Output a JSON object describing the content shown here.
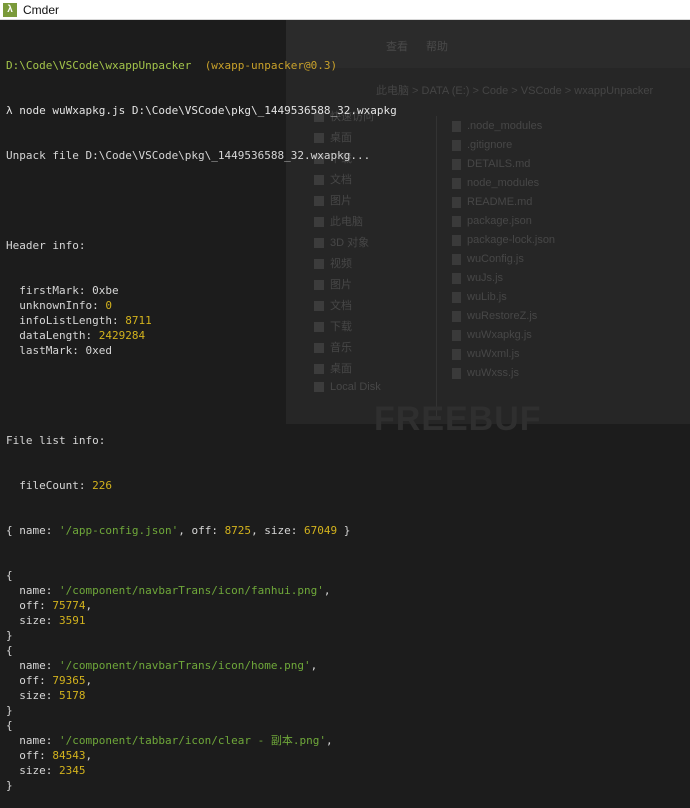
{
  "window": {
    "title": "Cmder"
  },
  "background": {
    "tabs": [
      "查看",
      "帮助"
    ],
    "address": "  此电脑  >  DATA (E:)  >  Code  >  VSCode  >  wxappUnpacker",
    "sidebar": [
      "快速访问",
      "桌面",
      "下载",
      "文档",
      "图片",
      "此电脑",
      "3D 对象",
      "视频",
      "图片",
      "文档",
      "下载",
      "音乐",
      "桌面",
      "Local Disk"
    ],
    "files": [
      ".node_modules",
      ".gitignore",
      "DETAILS.md",
      "node_modules",
      "README.md",
      "package.json",
      "package-lock.json",
      "wuConfig.js",
      "wuJs.js",
      "wuLib.js",
      "wuRestoreZ.js",
      "wuWxapkg.js",
      "wuWxml.js",
      "wuWxss.js"
    ],
    "watermark": "FREEBUF"
  },
  "console": {
    "prompt_path": "D:\\Code\\VSCode\\wxappUnpacker",
    "prompt_pkg": "(wxapp-unpacker@0.3)",
    "command": "λ node wuWxapkg.js D:\\Code\\VSCode\\pkg\\_1449536588_32.wxapkg",
    "unpack_line": "Unpack file D:\\Code\\VSCode\\pkg\\_1449536588_32.wxapkg...",
    "header_title": "Header info:",
    "header": [
      {
        "key": "  firstMark: ",
        "value": "0xbe",
        "type": "plain"
      },
      {
        "key": "  unknownInfo: ",
        "value": "0",
        "type": "num"
      },
      {
        "key": "  infoListLength: ",
        "value": "8711",
        "type": "num"
      },
      {
        "key": "  dataLength: ",
        "value": "2429284",
        "type": "num"
      },
      {
        "key": "  lastMark: ",
        "value": "0xed",
        "type": "plain"
      }
    ],
    "filelist_title": "File list info:",
    "file_count_key": "  fileCount: ",
    "file_count": "226",
    "first_entry": {
      "name": "'/app-config.json'",
      "off": "8725",
      "size": "67049"
    },
    "entries": [
      {
        "name": "'/component/navbarTrans/icon/fanhui.png'",
        "off": "75774",
        "size": "3591"
      },
      {
        "name": "'/component/navbarTrans/icon/home.png'",
        "off": "79365",
        "size": "5178"
      },
      {
        "name": "'/component/tabbar/icon/clear - 副本.png'",
        "off": "84543",
        "size": "2345"
      }
    ]
  }
}
